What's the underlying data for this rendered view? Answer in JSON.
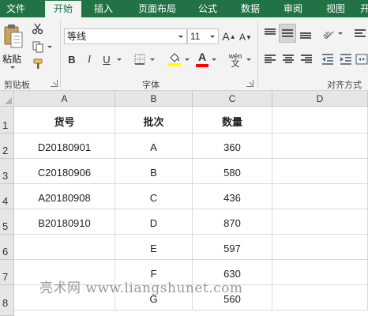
{
  "ribbon": {
    "tabs": [
      {
        "label": "文件"
      },
      {
        "label": "开始"
      },
      {
        "label": "插入"
      },
      {
        "label": "页面布局"
      },
      {
        "label": "公式"
      },
      {
        "label": "数据"
      },
      {
        "label": "审阅"
      },
      {
        "label": "视图"
      },
      {
        "label": "开"
      }
    ],
    "active_tab": "开始",
    "clipboard": {
      "paste_label": "粘贴",
      "group_label": "剪贴板"
    },
    "font": {
      "font_name": "等线",
      "font_size": "11",
      "bold_label": "B",
      "italic_label": "I",
      "underline_label": "U",
      "grow_label": "A",
      "shrink_label": "A",
      "font_color_label": "A",
      "phonetic_label": "wén",
      "phonetic_sub": "文",
      "group_label": "字体",
      "fill_color": "#ffff00",
      "font_color": "#ff0000"
    },
    "alignment": {
      "group_label": "对齐方式"
    },
    "accent_color": "#217346"
  },
  "sheet": {
    "columns": [
      "A",
      "B",
      "C",
      "D"
    ],
    "rows": [
      "1",
      "2",
      "3",
      "4",
      "5",
      "6",
      "7",
      "8"
    ],
    "header_row": [
      "货号",
      "批次",
      "数量"
    ],
    "data_rows": [
      [
        "D20180901",
        "A",
        "360"
      ],
      [
        "C20180906",
        "B",
        "580"
      ],
      [
        "A20180908",
        "C",
        "436"
      ],
      [
        "B20180910",
        "D",
        "870"
      ],
      [
        "",
        "E",
        "597"
      ],
      [
        "",
        "F",
        "630"
      ],
      [
        "",
        "G",
        "560"
      ]
    ]
  },
  "watermark": "亮术网 www.liangshunet.com"
}
